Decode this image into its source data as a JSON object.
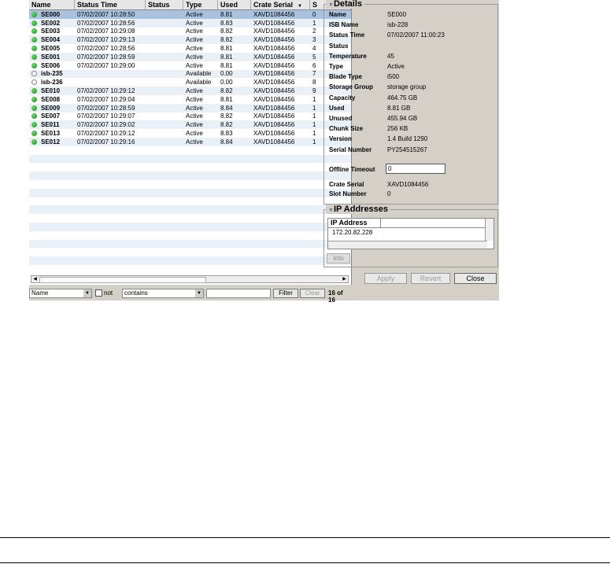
{
  "table": {
    "headers": [
      "Name",
      "Status Time",
      "Status",
      "Type",
      "Used",
      "Crate Serial",
      "S"
    ],
    "rows": [
      {
        "name": "SE000",
        "time": "07/02/2007 10:28:50",
        "status": "",
        "type": "Active",
        "used": "8.81",
        "crate": "XAVD1084456",
        "s": "0",
        "icon": "green"
      },
      {
        "name": "SE002",
        "time": "07/02/2007 10:28:56",
        "status": "",
        "type": "Active",
        "used": "8.83",
        "crate": "XAVD1084456",
        "s": "1",
        "icon": "green"
      },
      {
        "name": "SE003",
        "time": "07/02/2007 10:29:08",
        "status": "",
        "type": "Active",
        "used": "8.82",
        "crate": "XAVD1084456",
        "s": "2",
        "icon": "green"
      },
      {
        "name": "SE004",
        "time": "07/02/2007 10:29:13",
        "status": "",
        "type": "Active",
        "used": "8.82",
        "crate": "XAVD1084456",
        "s": "3",
        "icon": "green"
      },
      {
        "name": "SE005",
        "time": "07/02/2007 10:28:56",
        "status": "",
        "type": "Active",
        "used": "8.81",
        "crate": "XAVD1084456",
        "s": "4",
        "icon": "green"
      },
      {
        "name": "SE001",
        "time": "07/02/2007 10:28:59",
        "status": "",
        "type": "Active",
        "used": "8.81",
        "crate": "XAVD1084456",
        "s": "5",
        "icon": "green"
      },
      {
        "name": "SE006",
        "time": "07/02/2007 10:29:00",
        "status": "",
        "type": "Active",
        "used": "8.81",
        "crate": "XAVD1084456",
        "s": "6",
        "icon": "green"
      },
      {
        "name": "isb-235",
        "time": "",
        "status": "",
        "type": "Available",
        "used": "0.00",
        "crate": "XAVD1084456",
        "s": "7",
        "icon": "empty"
      },
      {
        "name": "isb-236",
        "time": "",
        "status": "",
        "type": "Available",
        "used": "0.00",
        "crate": "XAVD1084456",
        "s": "8",
        "icon": "empty"
      },
      {
        "name": "SE010",
        "time": "07/02/2007 10:29:12",
        "status": "",
        "type": "Active",
        "used": "8.82",
        "crate": "XAVD1084456",
        "s": "9",
        "icon": "green"
      },
      {
        "name": "SE008",
        "time": "07/02/2007 10:29:04",
        "status": "",
        "type": "Active",
        "used": "8.81",
        "crate": "XAVD1084456",
        "s": "1",
        "icon": "green"
      },
      {
        "name": "SE009",
        "time": "07/02/2007 10:28:59",
        "status": "",
        "type": "Active",
        "used": "8.84",
        "crate": "XAVD1084456",
        "s": "1",
        "icon": "green"
      },
      {
        "name": "SE007",
        "time": "07/02/2007 10:29:07",
        "status": "",
        "type": "Active",
        "used": "8.82",
        "crate": "XAVD1084456",
        "s": "1",
        "icon": "green"
      },
      {
        "name": "SE011",
        "time": "07/02/2007 10:29:02",
        "status": "",
        "type": "Active",
        "used": "8.82",
        "crate": "XAVD1084456",
        "s": "1",
        "icon": "green"
      },
      {
        "name": "SE013",
        "time": "07/02/2007 10:29:12",
        "status": "",
        "type": "Active",
        "used": "8.83",
        "crate": "XAVD1084456",
        "s": "1",
        "icon": "green"
      },
      {
        "name": "SE012",
        "time": "07/02/2007 10:29:16",
        "status": "",
        "type": "Active",
        "used": "8.84",
        "crate": "XAVD1084456",
        "s": "1",
        "icon": "green"
      }
    ],
    "sort_indicator": "▼"
  },
  "filter": {
    "field": "Name",
    "not_label": "not",
    "operator": "contains",
    "value": "",
    "filter_label": "Filter",
    "clear_label": "Clear",
    "count": "16 of 16"
  },
  "details": {
    "title": "Details",
    "fields": [
      {
        "label": "Name",
        "value": "SE000"
      },
      {
        "label": "ISB Name",
        "value": "isb-228"
      },
      {
        "label": "Status Time",
        "value": "07/02/2007 11:00:23"
      },
      {
        "label": "Status",
        "value": ""
      },
      {
        "label": "Temperature",
        "value": "45"
      },
      {
        "label": "Type",
        "value": "Active"
      },
      {
        "label": "Blade Type",
        "value": "i500"
      },
      {
        "label": "Storage Group",
        "value": "storage group"
      },
      {
        "label": "Capacity",
        "value": "464.75 GB"
      },
      {
        "label": "Used",
        "value": "8.81 GB"
      },
      {
        "label": "Unused",
        "value": "455.94 GB"
      },
      {
        "label": "Chunk Size",
        "value": "256 KB"
      },
      {
        "label": "Version",
        "value": "1.4 Build 1290"
      },
      {
        "label": "Serial Number",
        "value": "PY254515267"
      }
    ],
    "offline_timeout_label": "Offline Timeout",
    "offline_timeout_value": "0",
    "crate_serial_label": "Crate Serial",
    "crate_serial_value": "XAVD1084456",
    "slot_number_label": "Slot Number",
    "slot_number_value": "0"
  },
  "ip": {
    "title": "IP Addresses",
    "header": "IP Address",
    "addresses": [
      "172.20.82.228"
    ],
    "info_label": "Info"
  },
  "buttons": {
    "apply": "Apply",
    "revert": "Revert",
    "close": "Close"
  },
  "colors": {
    "selected_row": "#a9c2de",
    "alt_row": "#eaf0f8",
    "panel": "#d4d0c8",
    "status_green": "#22aa22"
  }
}
